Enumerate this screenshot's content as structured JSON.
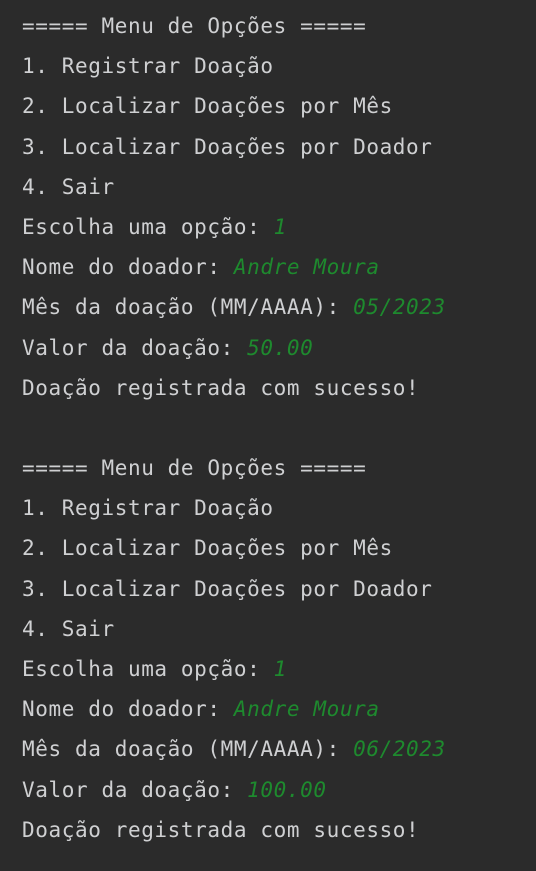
{
  "console": {
    "lines": [
      {
        "text": "===== Menu de Opções =====",
        "input": ""
      },
      {
        "text": "1. Registrar Doação",
        "input": ""
      },
      {
        "text": "2. Localizar Doações por Mês",
        "input": ""
      },
      {
        "text": "3. Localizar Doações por Doador",
        "input": ""
      },
      {
        "text": "4. Sair",
        "input": ""
      },
      {
        "text": "Escolha uma opção: ",
        "input": "1"
      },
      {
        "text": "Nome do doador: ",
        "input": "Andre Moura"
      },
      {
        "text": "Mês da doação (MM/AAAA): ",
        "input": "05/2023"
      },
      {
        "text": "Valor da doação: ",
        "input": "50.00"
      },
      {
        "text": "Doação registrada com sucesso!",
        "input": ""
      },
      {
        "text": "",
        "input": ""
      },
      {
        "text": "===== Menu de Opções =====",
        "input": ""
      },
      {
        "text": "1. Registrar Doação",
        "input": ""
      },
      {
        "text": "2. Localizar Doações por Mês",
        "input": ""
      },
      {
        "text": "3. Localizar Doações por Doador",
        "input": ""
      },
      {
        "text": "4. Sair",
        "input": ""
      },
      {
        "text": "Escolha uma opção: ",
        "input": "1"
      },
      {
        "text": "Nome do doador: ",
        "input": "Andre Moura"
      },
      {
        "text": "Mês da doação (MM/AAAA): ",
        "input": "06/2023"
      },
      {
        "text": "Valor da doação: ",
        "input": "100.00"
      },
      {
        "text": "Doação registrada com sucesso!",
        "input": ""
      }
    ]
  },
  "colors": {
    "background": "#2b2b2b",
    "text": "#cfd0d2",
    "input": "#1e8a2e"
  }
}
